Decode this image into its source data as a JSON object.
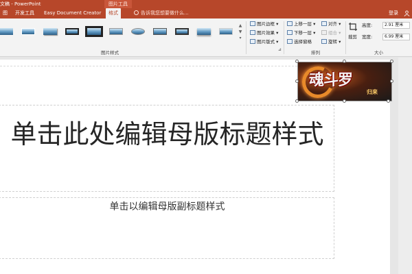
{
  "titlebar": {
    "doc_title": "文稿 - PowerPoint",
    "tools_label": "图片工具"
  },
  "tabs": [
    {
      "label": "图"
    },
    {
      "label": "开发工具"
    },
    {
      "label": "Easy Document Creator"
    },
    {
      "label": "格式",
      "active": true
    }
  ],
  "search": {
    "placeholder": "告诉我您想要做什么..."
  },
  "account": {
    "login_label": "登录"
  },
  "ribbon": {
    "styles_group_label": "图片样式",
    "arrange_group_label": "排列",
    "size_group_label": "大小",
    "picture_commands": [
      {
        "label": "图片边框",
        "arrow": "▾"
      },
      {
        "label": "图片效果",
        "arrow": "▾"
      },
      {
        "label": "图片版式",
        "arrow": "▾"
      }
    ],
    "arrange_commands": [
      {
        "label": "上移一层",
        "arrow": "▾"
      },
      {
        "label": "下移一层",
        "arrow": "▾"
      },
      {
        "label": "选择窗格",
        "arrow": ""
      },
      {
        "label": "对齐",
        "arrow": "▾",
        "disabled": false
      },
      {
        "label": "组合",
        "arrow": "▾",
        "disabled": true
      },
      {
        "label": "旋转",
        "arrow": "▾",
        "disabled": false
      }
    ],
    "crop_label": "裁剪",
    "height_label": "高度:",
    "height_value": "2.91 厘米",
    "width_label": "宽度:",
    "width_value": "6.99 厘米"
  },
  "slide": {
    "title_text": "单击此处编辑母版标题样式",
    "subtitle_text": "单击以编辑母版副标题样式",
    "picture_text": "魂斗罗",
    "picture_subtext": "归来"
  },
  "colors": {
    "accent": "#b7472a",
    "ribbon_bg": "#f3f3f3",
    "workspace_bg": "#e6e6e6"
  }
}
